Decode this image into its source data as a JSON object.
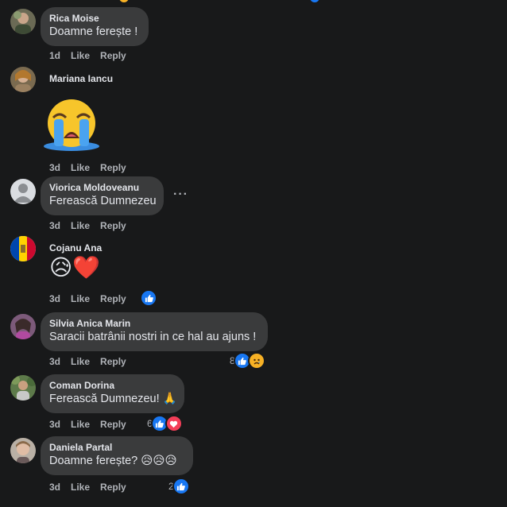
{
  "comments": [
    {
      "name": "Rica Moise",
      "text": "Doamne ferește !",
      "time": "1d",
      "like": "Like",
      "reply": "Reply"
    },
    {
      "name": "Mariana Iancu",
      "sticker": "crying-face-emoji",
      "time": "3d",
      "like": "Like",
      "reply": "Reply"
    },
    {
      "name": "Viorica Moldoveanu",
      "text": "Ferească Dumnezeu",
      "time": "3d",
      "like": "Like",
      "reply": "Reply",
      "more": "···"
    },
    {
      "name": "Cojanu Ana",
      "emoji": "😥❤️",
      "time": "3d",
      "like": "Like",
      "reply": "Reply",
      "reactions": [
        "like"
      ]
    },
    {
      "name": "Silvia Anica Marin",
      "text": "Saracii batrânii nostri in ce hal au ajuns !",
      "time": "3d",
      "like": "Like",
      "reply": "Reply",
      "reaction_count": "8",
      "reactions": [
        "like",
        "sad"
      ]
    },
    {
      "name": "Coman Dorina",
      "text": "Ferească Dumnezeu! 🙏",
      "time": "3d",
      "like": "Like",
      "reply": "Reply",
      "reaction_count": "6",
      "reactions": [
        "like",
        "love"
      ]
    },
    {
      "name": "Daniela Partal",
      "text": "Doamne ferește? 😥😥😥",
      "time": "3d",
      "like": "Like",
      "reply": "Reply",
      "reaction_count": "2",
      "reactions": [
        "like"
      ]
    }
  ],
  "colors": {
    "background": "#18191a",
    "bubble": "#3a3b3c",
    "like": "#1877f2",
    "love": "#f33e58",
    "sad": "#f7b125"
  }
}
